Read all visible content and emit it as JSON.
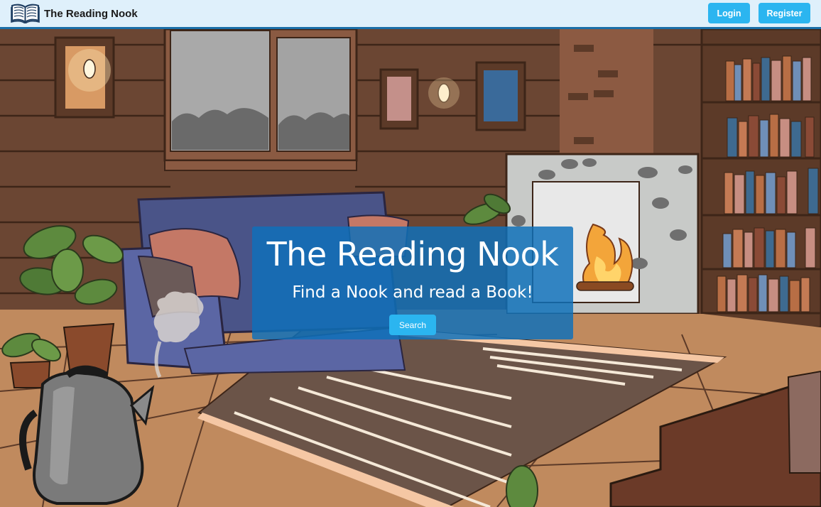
{
  "navbar": {
    "brand_name": "The Reading Nook",
    "brand_icon": "open-book-icon",
    "login_label": "Login",
    "register_label": "Register"
  },
  "hero": {
    "title": "The Reading Nook",
    "subtitle": "Find a Nook and read a Book!",
    "search_label": "Search",
    "background": "illustrated cozy cabin reading room"
  },
  "colors": {
    "navbar_bg": "#dff0fb",
    "navbar_border": "#1b6fa8",
    "button": "#2bb5f0",
    "card_overlay": "#0e70ba"
  }
}
